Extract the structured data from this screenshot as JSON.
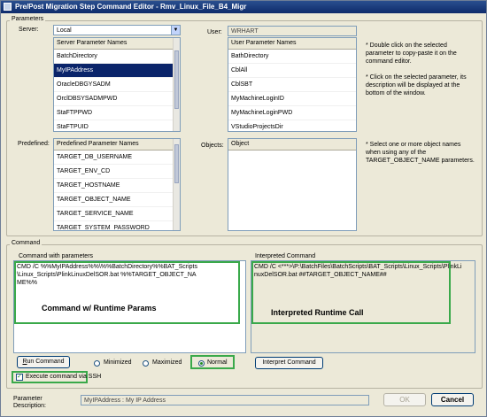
{
  "window": {
    "title": "Pre/Post Migration Step Command Editor - Rmv_Linux_File_B4_Migr"
  },
  "parameters": {
    "group_label": "Parameters",
    "server_label": "Server:",
    "server_value": "Local",
    "user_label": "User:",
    "user_value": "WRHART",
    "server_params_header": "Server Parameter Names",
    "server_params": [
      "BatchDirectory",
      "MyIPAddress",
      "OracleDBGYSADM",
      "OrclDBSYSADMPWD",
      "StaFTPPWD",
      "StaFTPUID"
    ],
    "server_params_selected": 1,
    "user_params_header": "User Parameter Names",
    "user_params": [
      "BathDirectory",
      "CblAll",
      "CblSBT",
      "MyMachineLoginID",
      "MyMachineLoginPWD",
      "VStudioProjectsDir"
    ],
    "predefined_label": "Predefined:",
    "predefined_header": "Predefined Parameter Names",
    "predefined_params": [
      "TARGET_DB_USERNAME",
      "TARGET_ENV_CD",
      "TARGET_HOSTNAME",
      "TARGET_OBJECT_NAME",
      "TARGET_SERVICE_NAME",
      "TARGET_SYSTEM_PASSWORD"
    ],
    "objects_label": "Objects:",
    "objects_header": "Object",
    "note1": "* Double click on the selected parameter to copy-paste it on the command editor.",
    "note2": "* Click on the selected parameter, its description will be displayed at the bottom of the window.",
    "note3": "* Select one or more object names when using any of the TARGET_OBJECT_NAME parameters."
  },
  "command": {
    "group_label": "Command",
    "with_params_label": "Command with parameters",
    "with_params_text": "CMD /C %%MyIPAddress%%\\%%BatchDirectory%%BAT_Scripts\\Linux_Scripts\\PlinkLinuxDelSOR.bat %%TARGET_OBJECT_NAME%%",
    "callout_left": "Command w/ Runtime Params",
    "interpreted_label": "Interpreted Command",
    "interpreted_text": "CMD /C <***>\\P:\\BatchFiles\\BatchScripts\\BAT_Scripts\\Linux_Scripts\\PlinkLinuxDelSOR.bat ##TARGET_OBJECT_NAME##",
    "callout_right": "Interpreted Runtime Call",
    "run_button": "Run Command",
    "run_button_underline": "R",
    "run_button_rest": "un Command",
    "radio_minimized": "Minimized",
    "radio_maximized": "Maximized",
    "radio_normal": "Normal",
    "interpret_button": "Interpret Command",
    "ssh_checkbox": "Execute command via SSH"
  },
  "footer": {
    "param_desc_label": "Parameter Description:",
    "param_desc_value": "MyIPAddress : My IP Address",
    "ok_button": "OK",
    "cancel_button": "Cancel"
  },
  "colors": {
    "callout_green": "#3aa94a",
    "selection": "#0a246a",
    "title_bar": "#0e2b6b"
  }
}
